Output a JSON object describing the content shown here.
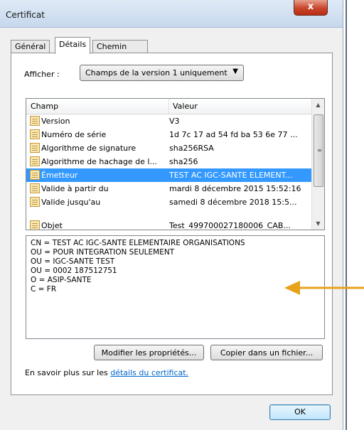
{
  "window": {
    "title": "Certificat",
    "close_label": "x"
  },
  "tabs": [
    {
      "label": "Général"
    },
    {
      "label": "Détails"
    },
    {
      "label": "Chemin d'accès de certification"
    }
  ],
  "show": {
    "label": "Afficher :",
    "selected": "Champs de la version 1 uniquement"
  },
  "list": {
    "columns": [
      "Champ",
      "Valeur"
    ],
    "rows": [
      {
        "field": "Version",
        "value": "V3"
      },
      {
        "field": "Numéro de série",
        "value": "1d 7c 17 ad 54 fd ba 53 6e 77 ..."
      },
      {
        "field": "Algorithme de signature",
        "value": "sha256RSA"
      },
      {
        "field": "Algorithme de hachage de l...",
        "value": "sha256"
      },
      {
        "field": "Émetteur",
        "value": "TEST AC IGC-SANTE ELEMENT..."
      },
      {
        "field": "Valide à partir du",
        "value": "mardi 8 décembre 2015 15:52:16"
      },
      {
        "field": "Valide jusqu'au",
        "value": "samedi 8 décembre 2018 15:5..."
      },
      {
        "field": "Objet",
        "value": "Test_499700027180006_CAB..."
      }
    ],
    "selected_index": 4
  },
  "detail_lines": [
    "CN = TEST AC IGC-SANTE ELEMENTAIRE ORGANISATIONS",
    "OU = POUR INTEGRATION SEULEMENT",
    "OU = IGC-SANTE TEST",
    "OU = 0002 187512751",
    "O = ASIP-SANTE",
    "C = FR"
  ],
  "buttons": {
    "edit_properties": "Modifier les propriétés...",
    "copy_to_file": "Copier dans un fichier...",
    "ok": "OK"
  },
  "learn_more": {
    "prefix": "En savoir plus sur les ",
    "link": "détails du certificat."
  },
  "colors": {
    "selection": "#3399ff",
    "link": "#0066cc",
    "annotation_arrow": "#e8a21a"
  }
}
